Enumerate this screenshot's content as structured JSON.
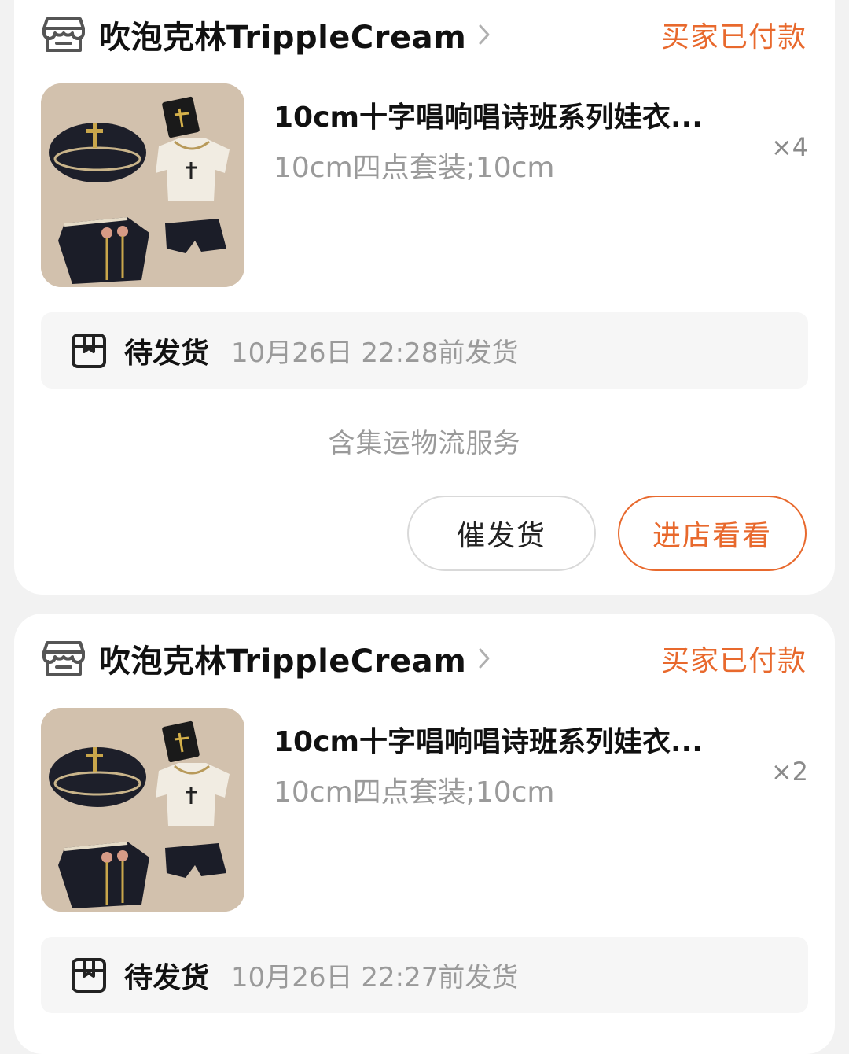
{
  "orders": [
    {
      "shop_name": "吹泡克林TrippleCream",
      "status": "买家已付款",
      "product_title": "10cm十字唱响唱诗班系列娃衣...",
      "product_spec": "10cm四点套装;10cm",
      "quantity": "×4",
      "ship_status": "待发货",
      "ship_deadline": "10月26日 22:28前发货",
      "service_note": "含集运物流服务",
      "buttons": {
        "urge": "催发货",
        "visit_store": "进店看看"
      }
    },
    {
      "shop_name": "吹泡克林TrippleCream",
      "status": "买家已付款",
      "product_title": "10cm十字唱响唱诗班系列娃衣...",
      "product_spec": "10cm四点套装;10cm",
      "quantity": "×2",
      "ship_status": "待发货",
      "ship_deadline": "10月26日 22:27前发货"
    }
  ],
  "colors": {
    "accent": "#e8692d",
    "page_background": "#f2f2f2",
    "card": "#ffffff",
    "muted_text": "#9a9a9a"
  },
  "icons": {
    "shop": "store-icon",
    "chevron": "chevron-right-icon",
    "shipping": "package-box-icon"
  }
}
